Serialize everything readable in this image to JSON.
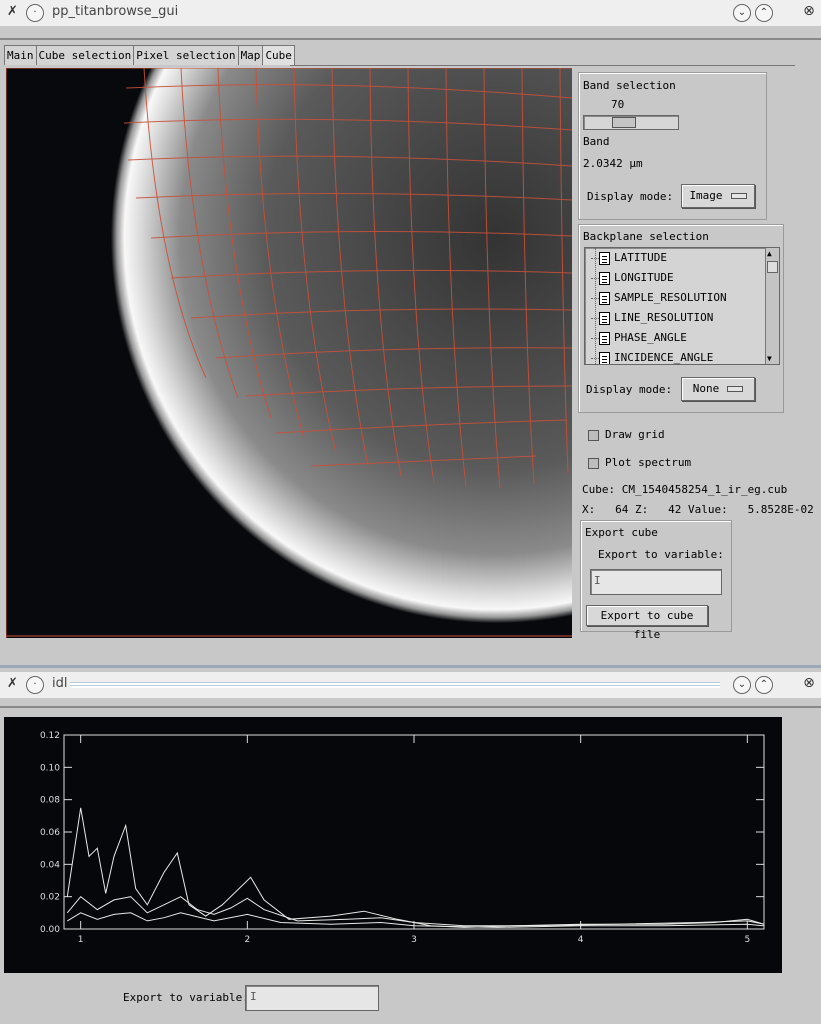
{
  "top_window": {
    "title": "pp_titanbrowse_gui",
    "tabs": [
      "Main",
      "Cube selection",
      "Pixel selection",
      "Map",
      "Cube"
    ]
  },
  "band_panel": {
    "title": "Band selection",
    "slider_value": "70",
    "band_label": "Band",
    "band_value": "2.0342 µm",
    "display_mode_label": "Display mode:",
    "display_mode_value": "Image"
  },
  "backplane_panel": {
    "title": "Backplane selection",
    "items": [
      "LATITUDE",
      "LONGITUDE",
      "SAMPLE_RESOLUTION",
      "LINE_RESOLUTION",
      "PHASE_ANGLE",
      "INCIDENCE_ANGLE"
    ],
    "display_mode_label": "Display mode:",
    "display_mode_value": "None"
  },
  "options": {
    "draw_grid": "Draw grid",
    "plot_spectrum": "Plot spectrum"
  },
  "info": {
    "cube_line": "Cube: CM_1540458254_1_ir_eg.cub",
    "pixel_line": "X:   64 Z:   42 Value:   5.8528E-02"
  },
  "export_panel": {
    "title": "Export cube",
    "variable_label": "Export to variable:",
    "file_button": "Export to cube file"
  },
  "bottom_window": {
    "title": "idl",
    "export_label": "Export to variable:"
  },
  "chart_data": {
    "type": "line",
    "xlim": [
      0.9,
      5.1
    ],
    "ylim": [
      0,
      0.12
    ],
    "x_ticks": [
      "1",
      "2",
      "3",
      "4",
      "5"
    ],
    "y_ticks": [
      "0.00",
      "0.02",
      "0.04",
      "0.06",
      "0.08",
      "0.10",
      "0.12"
    ],
    "series": [
      {
        "x": [
          0.92,
          1.0,
          1.05,
          1.1,
          1.15,
          1.2,
          1.27,
          1.33,
          1.4,
          1.5,
          1.58,
          1.65,
          1.75,
          1.85,
          1.95,
          2.02,
          2.1,
          2.25,
          2.5,
          2.7,
          2.9,
          3.1,
          3.3,
          3.6,
          4.0,
          4.5,
          4.8,
          5.0,
          5.1
        ],
        "y": [
          0.02,
          0.075,
          0.045,
          0.05,
          0.022,
          0.045,
          0.064,
          0.025,
          0.015,
          0.035,
          0.047,
          0.015,
          0.008,
          0.015,
          0.025,
          0.032,
          0.018,
          0.006,
          0.008,
          0.011,
          0.006,
          0.002,
          0.001,
          0.002,
          0.003,
          0.003,
          0.004,
          0.006,
          0.003
        ]
      },
      {
        "x": [
          0.92,
          1.0,
          1.1,
          1.2,
          1.3,
          1.4,
          1.5,
          1.6,
          1.7,
          1.8,
          1.9,
          2.0,
          2.1,
          2.3,
          2.6,
          2.8,
          3.0,
          3.3,
          3.7,
          4.2,
          4.7,
          5.0,
          5.1
        ],
        "y": [
          0.01,
          0.02,
          0.012,
          0.018,
          0.02,
          0.01,
          0.015,
          0.02,
          0.012,
          0.009,
          0.013,
          0.019,
          0.012,
          0.005,
          0.006,
          0.007,
          0.004,
          0.002,
          0.002,
          0.003,
          0.004,
          0.005,
          0.003
        ]
      },
      {
        "x": [
          0.92,
          1.0,
          1.1,
          1.2,
          1.3,
          1.4,
          1.5,
          1.6,
          1.8,
          2.0,
          2.2,
          2.5,
          2.8,
          3.0,
          3.5,
          4.0,
          4.5,
          5.0,
          5.1
        ],
        "y": [
          0.005,
          0.01,
          0.006,
          0.009,
          0.01,
          0.005,
          0.007,
          0.01,
          0.005,
          0.009,
          0.004,
          0.003,
          0.004,
          0.002,
          0.001,
          0.002,
          0.002,
          0.003,
          0.002
        ]
      }
    ]
  }
}
